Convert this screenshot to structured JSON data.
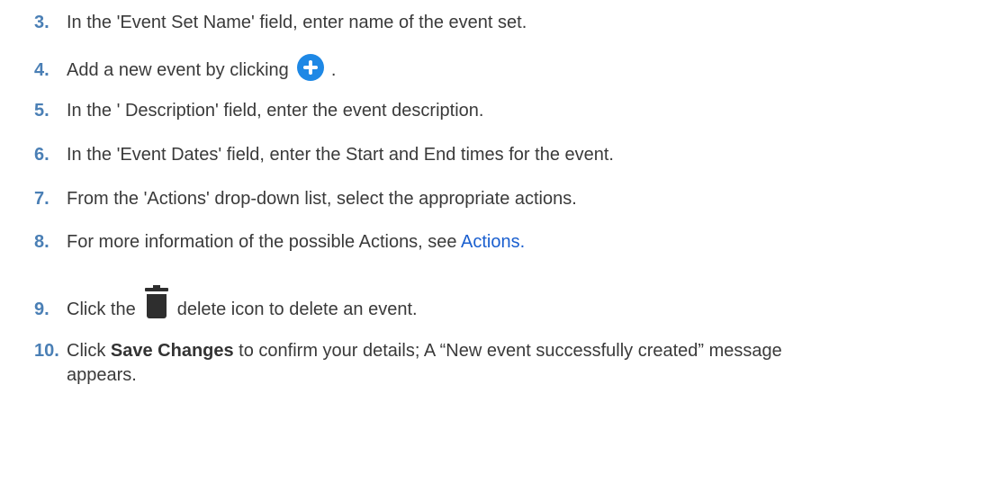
{
  "steps": [
    {
      "num": "3.",
      "text": "In the 'Event Set Name' field, enter name of the event set."
    },
    {
      "num": "4.",
      "text": "Add a new event by clicking",
      "after": " .",
      "icon": "add-circle-icon"
    },
    {
      "num": "5.",
      "text": "In the ' Description' field, enter the event description."
    },
    {
      "num": "6.",
      "text": "In the 'Event Dates' field, enter the Start and End times for the event."
    },
    {
      "num": "7.",
      "text": "From the 'Actions' drop-down list, select the appropriate actions."
    },
    {
      "num": "8.",
      "text": "For more information of the possible Actions, see ",
      "link": "Actions."
    },
    {
      "num": "9.",
      "before": "Click the",
      "after": "delete icon to delete an event.",
      "icon": "trash-icon"
    },
    {
      "num": "10.",
      "before": "Click ",
      "bold": "Save Changes",
      "after": " to confirm your details; A “New event successfully created” message",
      "cont": "appears."
    }
  ],
  "colors": {
    "number": "#4a7fb5",
    "link": "#1a5fcf",
    "add_icon": "#1e88e5",
    "trash_icon": "#2e2e2e"
  }
}
